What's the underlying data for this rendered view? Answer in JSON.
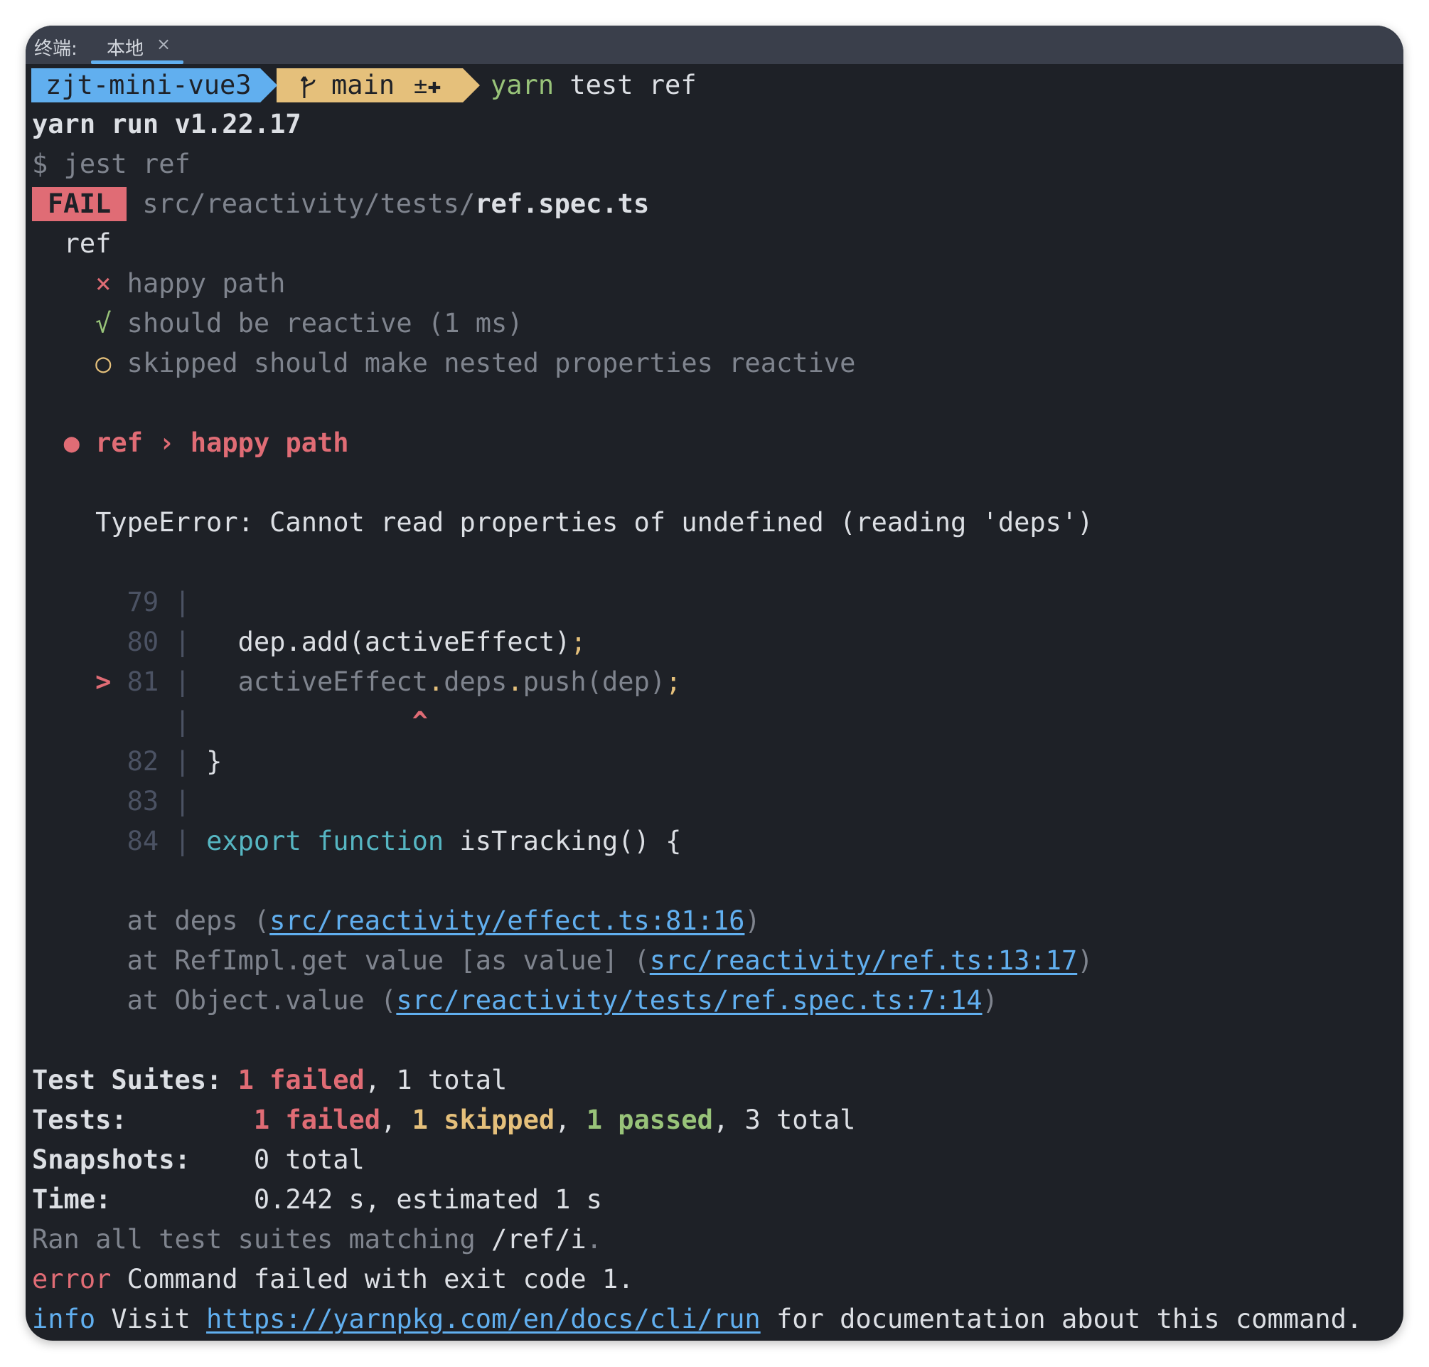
{
  "window": {
    "tab_label": "终端:",
    "tab_name": "本地",
    "tab_close": "×"
  },
  "prompt": {
    "directory": "zjt-mini-vue3",
    "branch_icon": "git-branch-icon",
    "branch": "main",
    "branch_status": "±✚",
    "command_name": "yarn",
    "command_args": " test ref"
  },
  "output": {
    "yarn_version": "yarn run v1.22.17",
    "jest_cmd": "$ jest ref",
    "fail_badge": "FAIL",
    "spec_dir": "src/reactivity/tests/",
    "spec_file": "ref.spec.ts",
    "describe": "ref",
    "tests": [
      {
        "icon": "×",
        "label": "happy path",
        "status": "failed"
      },
      {
        "icon": "√",
        "label": "should be reactive (1 ms)",
        "status": "passed"
      },
      {
        "icon": "○",
        "label": "skipped should make nested properties reactive",
        "status": "skipped"
      }
    ],
    "failure_bullet": "●",
    "failure_describe": "ref",
    "failure_sep": "›",
    "failure_test": "happy path",
    "error_message": "TypeError: Cannot read properties of undefined (reading 'deps')",
    "code_frame": [
      {
        "num": "79",
        "code": ""
      },
      {
        "num": "80",
        "code": "  dep.add(activeEffect);"
      },
      {
        "num": "81",
        "code": "  activeEffect.deps.push(dep);",
        "marker": ">"
      },
      {
        "num": "",
        "code": "",
        "caret": "^"
      },
      {
        "num": "82",
        "code": "}"
      },
      {
        "num": "83",
        "code": ""
      },
      {
        "num": "84",
        "keyword1": "export",
        "keyword2": "function",
        "code": "isTracking() {"
      }
    ],
    "stack": [
      {
        "prefix": "at deps (",
        "link": "src/reactivity/effect.ts:81:16",
        "suffix": ")"
      },
      {
        "prefix": "at RefImpl.get value [as value] (",
        "link": "src/reactivity/ref.ts:13:17",
        "suffix": ")"
      },
      {
        "prefix": "at Object.value (",
        "link": "src/reactivity/tests/ref.spec.ts:7:14",
        "suffix": ")"
      }
    ],
    "summary": {
      "suites_label": "Test Suites:",
      "suites_failed": "1 failed",
      "suites_total": ", 1 total",
      "tests_label": "Tests:",
      "tests_failed": "1 failed",
      "tests_skipped": "1 skipped",
      "tests_passed": "1 passed",
      "tests_total": ", 3 total",
      "snapshots_label": "Snapshots:",
      "snapshots_value": "0 total",
      "time_label": "Time:",
      "time_value": "0.242 s, estimated 1 s",
      "ran_text": "Ran all test suites matching",
      "ran_pattern": " /ref/i",
      "ran_end": "."
    },
    "error_word": "error",
    "error_text": " Command failed with exit code 1.",
    "info_word": "info",
    "info_prefix": " Visit ",
    "info_link": "https://yarnpkg.com/en/docs/cli/run",
    "info_suffix": " for documentation about this command."
  },
  "colors": {
    "background": "#1e2127",
    "tab_bar": "#3a3f4b",
    "red": "#e06c75",
    "green": "#98c379",
    "yellow": "#e5c07b",
    "blue": "#61afef",
    "cyan": "#56b6c2"
  }
}
